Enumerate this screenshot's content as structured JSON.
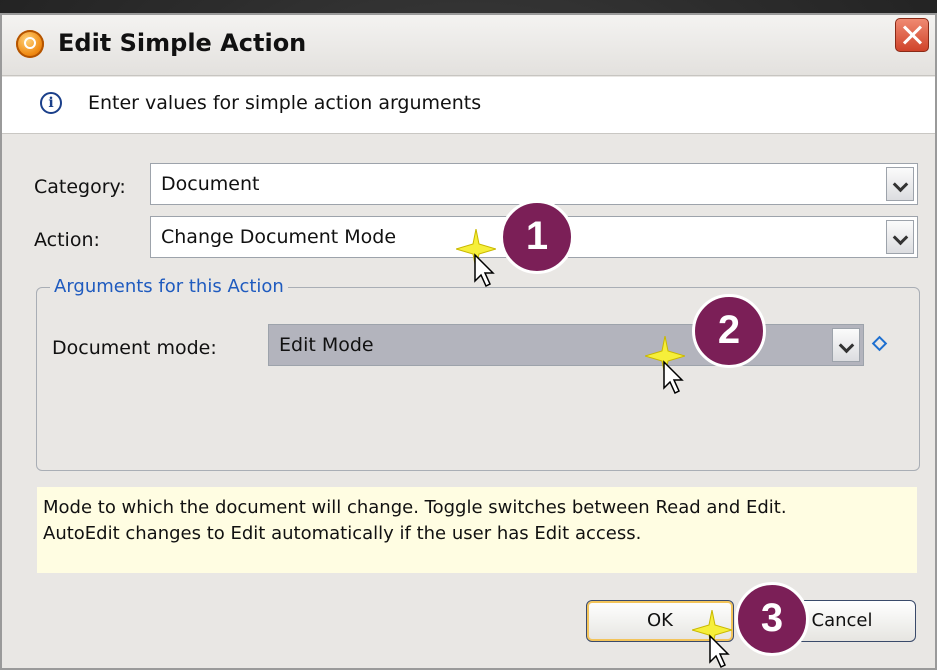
{
  "dialog": {
    "title": "Edit Simple Action",
    "info_text": "Enter values for simple action arguments"
  },
  "category": {
    "label": "Category:",
    "value": "Document"
  },
  "action": {
    "label": "Action:",
    "value": "Change Document Mode"
  },
  "arguments": {
    "legend": "Arguments for this Action",
    "document_mode_label": "Document mode:",
    "document_mode_value": "Edit Mode"
  },
  "help": {
    "line1": "Mode to which the document will change. Toggle switches between Read and Edit.",
    "line2": "AutoEdit changes to Edit automatically if the user has Edit access."
  },
  "buttons": {
    "ok": "OK",
    "cancel": "Cancel"
  },
  "steps": [
    "1",
    "2",
    "3"
  ],
  "colors": {
    "step_badge": "#7b1f57",
    "legend": "#1f5bbf",
    "help_bg": "#fffde2"
  },
  "icons": {
    "app": "app-icon",
    "close": "close-icon",
    "info": "info-icon",
    "dropdown": "chevron-down-icon",
    "required": "diamond-icon"
  }
}
